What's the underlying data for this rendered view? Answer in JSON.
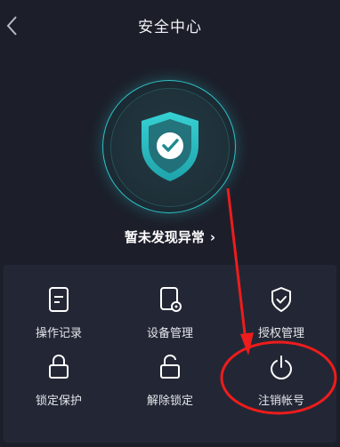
{
  "header": {
    "title": "安全中心",
    "back_icon": "chevron-left-icon"
  },
  "security": {
    "shield_icon": "shield-check-icon",
    "status_text": "暂未发现异常",
    "status_chevron": "›",
    "accent_color": "#2ec4c9"
  },
  "grid": {
    "items": [
      {
        "label": "操作记录",
        "icon": "document-icon"
      },
      {
        "label": "设备管理",
        "icon": "device-settings-icon"
      },
      {
        "label": "授权管理",
        "icon": "shield-check-icon"
      },
      {
        "label": "锁定保护",
        "icon": "lock-icon"
      },
      {
        "label": "解除锁定",
        "icon": "unlock-icon"
      },
      {
        "label": "注销帐号",
        "icon": "power-icon"
      }
    ]
  },
  "annotation": {
    "color": "#ee1c1c"
  }
}
